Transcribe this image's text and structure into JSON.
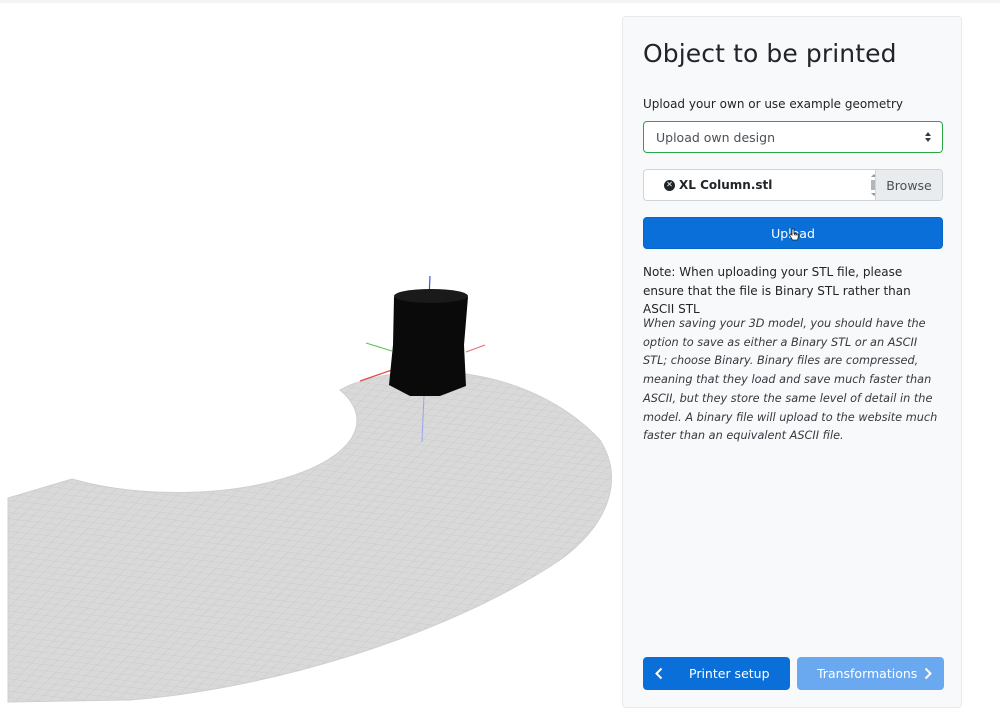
{
  "viewer": {
    "object_color": "#0a0a0a",
    "bed_color": "#d9d9d9",
    "grid_color": "#c2c2c2"
  },
  "panel": {
    "title": "Object to be printed",
    "source_label": "Upload your own or use example geometry",
    "source_select": {
      "selected": "Upload own design"
    },
    "file_input": {
      "file_name": "XL Column.stl",
      "browse_label": "Browse"
    },
    "upload_button": "Upload",
    "note": "Note: When uploading your STL file, please ensure that the file is Binary STL rather than ASCII STL",
    "info": "When saving your 3D model, you should have the option to save as either a Binary STL or an ASCII STL; choose Binary. Binary files are compressed, meaning that they load and save much faster than ASCII, but they store the same level of detail in the model. A binary file will upload to the website much faster than an equivalent ASCII file.",
    "nav": {
      "prev_label": "Printer setup",
      "next_label": "Transformations"
    }
  },
  "colors": {
    "primary": "#0a6fd8",
    "primary_light": "#6aa9ef",
    "select_border": "#28a745"
  }
}
